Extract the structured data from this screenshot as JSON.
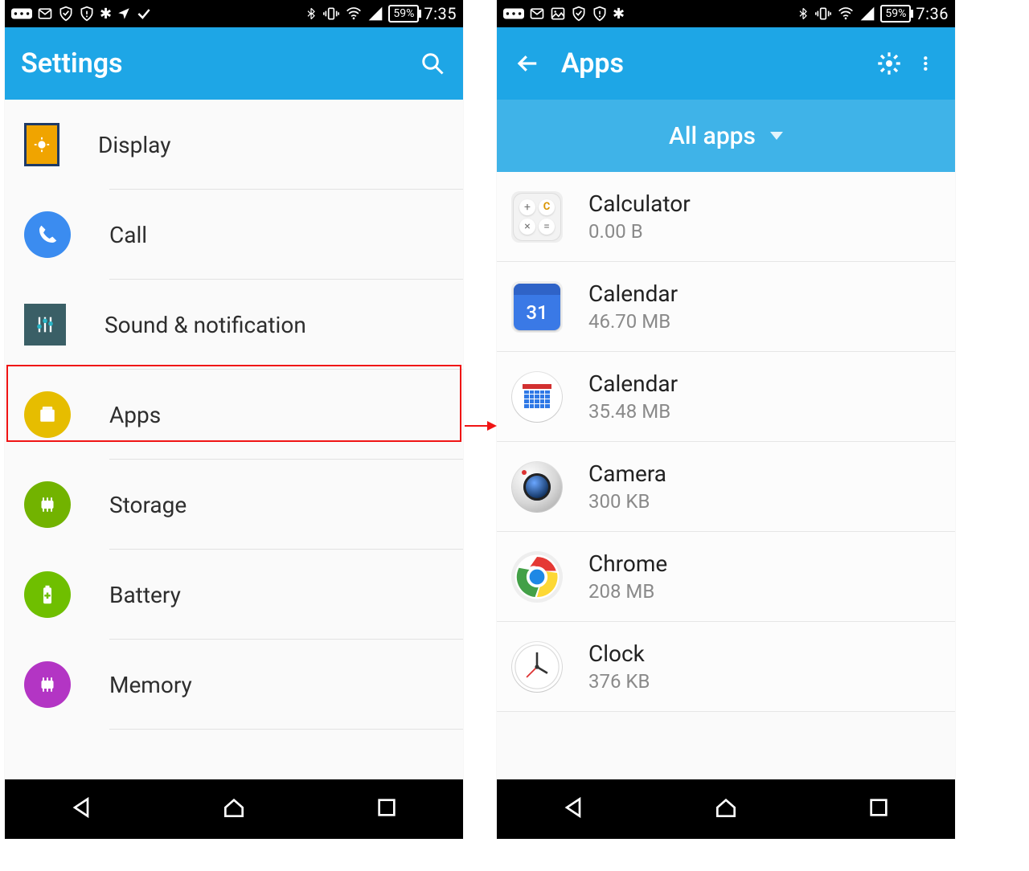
{
  "left": {
    "statusbar": {
      "battery": "59%",
      "time": "7:35"
    },
    "appbar_title": "Settings",
    "items": [
      {
        "label": "Display",
        "color": "#f0a400",
        "shape": "display"
      },
      {
        "label": "Call",
        "color": "#3b8cf0",
        "shape": "phone"
      },
      {
        "label": "Sound & notification",
        "color": "#3a5f66",
        "shape": "sliders"
      },
      {
        "label": "Apps",
        "color": "#e6bd00",
        "shape": "apps"
      },
      {
        "label": "Storage",
        "color": "#72b300",
        "shape": "chip"
      },
      {
        "label": "Battery",
        "color": "#6fbf00",
        "shape": "battery"
      },
      {
        "label": "Memory",
        "color": "#b335c4",
        "shape": "chip"
      }
    ],
    "highlight_index": 3
  },
  "right": {
    "statusbar": {
      "battery": "59%",
      "time": "7:36"
    },
    "appbar_title": "Apps",
    "filter_label": "All apps",
    "apps": [
      {
        "name": "Calculator",
        "size": "0.00 B",
        "icon": "calc"
      },
      {
        "name": "Calendar",
        "size": "46.70 MB",
        "icon": "cal31"
      },
      {
        "name": "Calendar",
        "size": "35.48 MB",
        "icon": "calgrid"
      },
      {
        "name": "Camera",
        "size": "300 KB",
        "icon": "camera"
      },
      {
        "name": "Chrome",
        "size": "208 MB",
        "icon": "chrome"
      },
      {
        "name": "Clock",
        "size": "376 KB",
        "icon": "clock"
      }
    ]
  }
}
